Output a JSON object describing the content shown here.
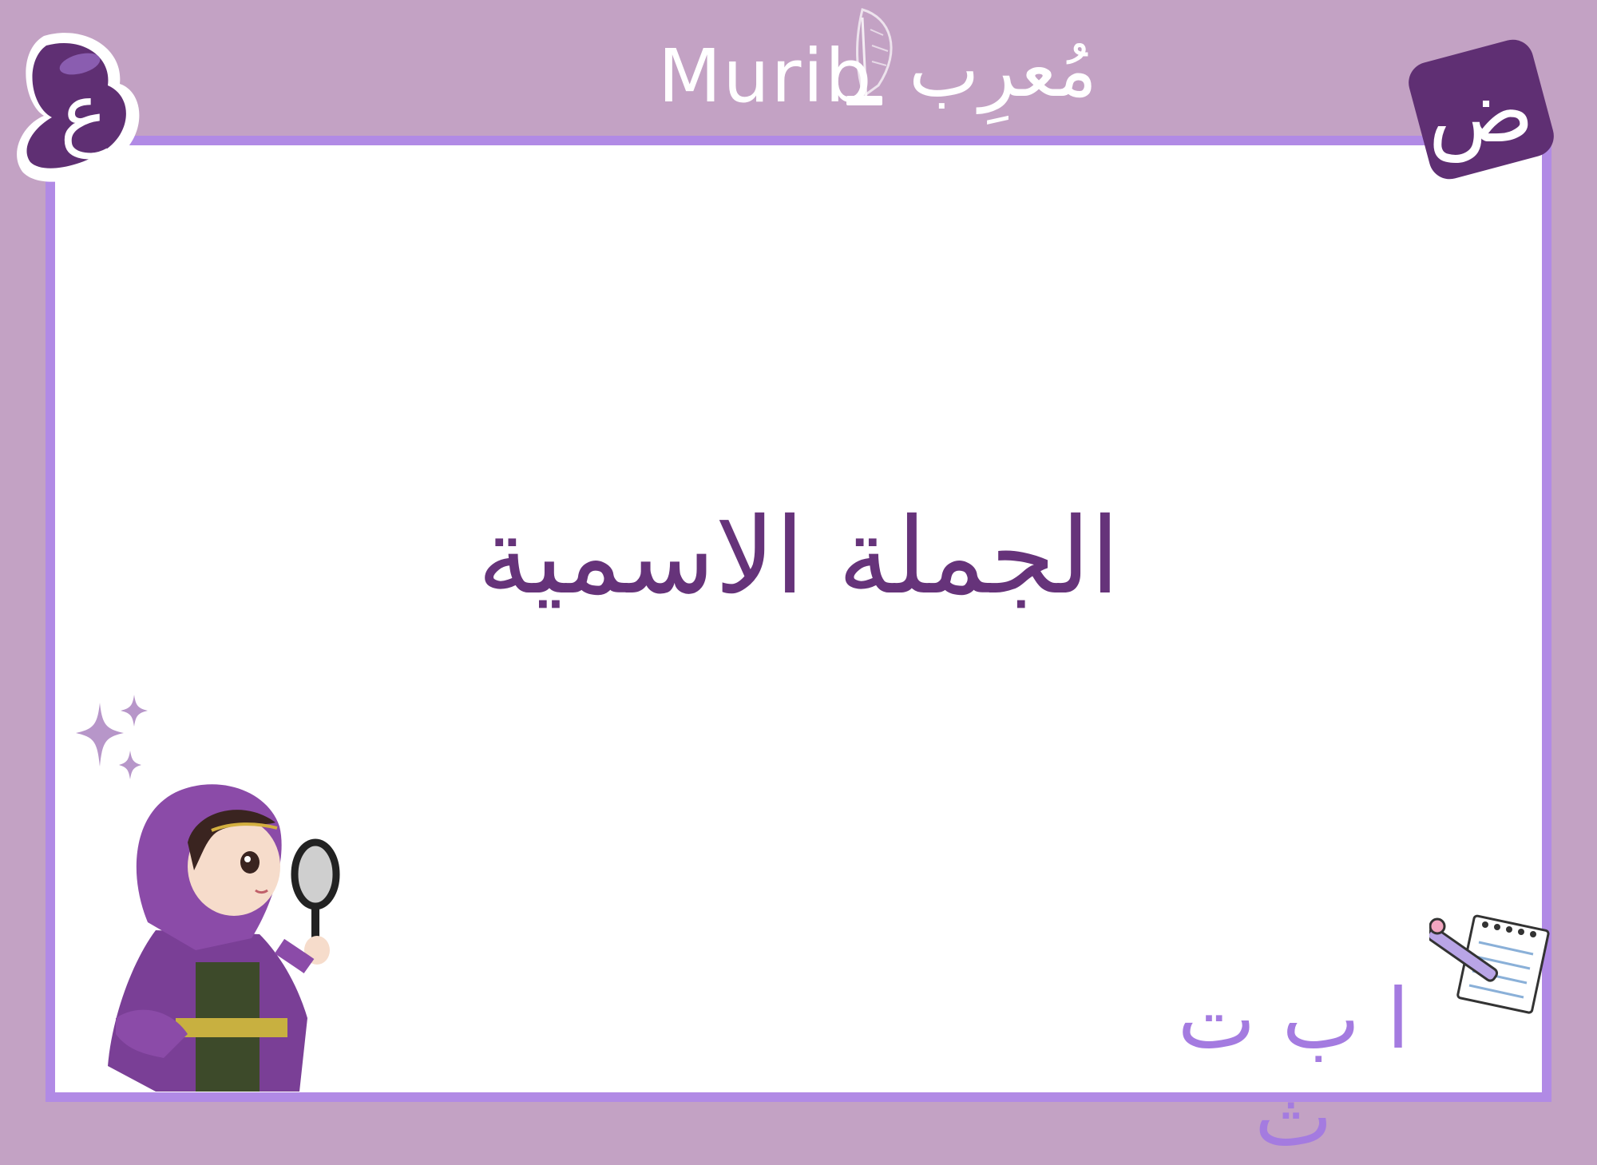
{
  "brand": {
    "latin": "Murib",
    "arabic": "مُعرِب",
    "accent_color": "#66337a",
    "frame_color": "#b18ae5",
    "background_color": "#c3a2c4"
  },
  "badges": {
    "left_letter": "ع",
    "right_letter": "ض"
  },
  "main": {
    "title": "الجملة الاسمية"
  },
  "footer": {
    "letters": "ا ب ت ث"
  },
  "decorations": {
    "icons": [
      "sparkles-icon",
      "detective-girl-illustration",
      "notepad-pencil-icon",
      "feather-quill-icon"
    ]
  }
}
